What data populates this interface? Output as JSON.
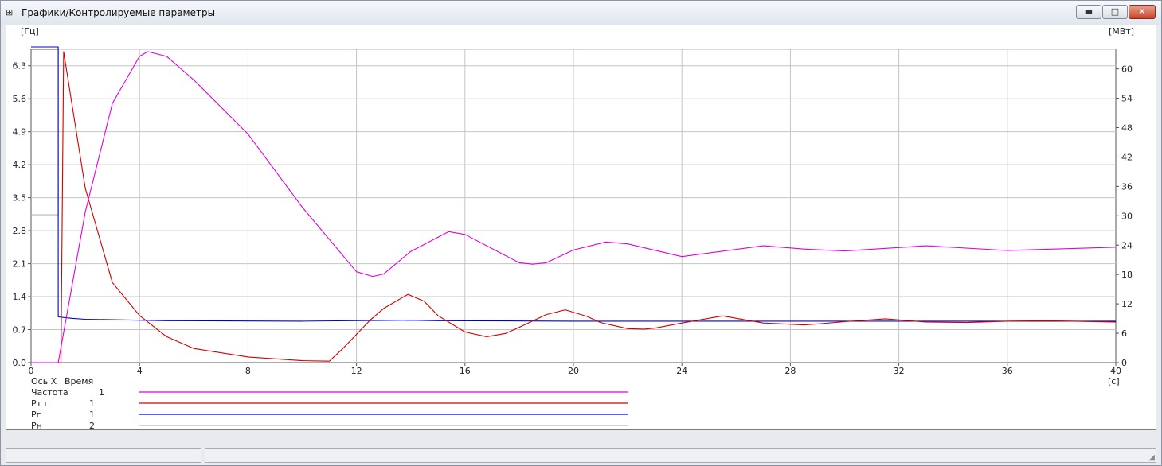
{
  "window": {
    "title": "Графики/Контролируемые параметры",
    "icon": "chart-app-icon",
    "controls": {
      "minimize": "▬",
      "maximize": "□",
      "close": "✕"
    }
  },
  "chart_data": {
    "type": "line",
    "left_unit": "[Гц]",
    "right_unit": "[МВт]",
    "x_unit": "[с]",
    "xlim": [
      0,
      40
    ],
    "ylim_left": [
      0,
      6.65
    ],
    "ylim_right": [
      0,
      64
    ],
    "x_ticks": [
      "0",
      "4",
      "8",
      "12",
      "16",
      "20",
      "24",
      "28",
      "32",
      "36",
      "40"
    ],
    "y_left_ticks": [
      "0.0",
      "0.7",
      "1.4",
      "2.1",
      "2.8",
      "3.5",
      "4.2",
      "4.9",
      "5.6",
      "6.3"
    ],
    "y_right_ticks": [
      "0",
      "6",
      "12",
      "18",
      "24",
      "30",
      "36",
      "42",
      "48",
      "54",
      "60"
    ],
    "grid": true,
    "legend_header": {
      "axis_x": "Ось X",
      "time": "Время"
    },
    "series": [
      {
        "name": "Частота",
        "axis": "1",
        "color": "#e000e0",
        "x": [
          0,
          1,
          2,
          3,
          4,
          4.3,
          5,
          6,
          8,
          10,
          12,
          12.6,
          13,
          14,
          15.4,
          16,
          18,
          18.5,
          19,
          20,
          21.2,
          22,
          24,
          27,
          28.5,
          30,
          33,
          36,
          40
        ],
        "y": [
          0,
          0,
          3.2,
          5.5,
          6.5,
          6.6,
          6.5,
          6.0,
          4.85,
          3.3,
          1.93,
          1.83,
          1.88,
          2.36,
          2.78,
          2.72,
          2.12,
          2.09,
          2.12,
          2.39,
          2.56,
          2.52,
          2.25,
          2.48,
          2.41,
          2.37,
          2.48,
          2.38,
          2.45
        ]
      },
      {
        "name": "Рт г",
        "axis": "1",
        "color": "#d00000",
        "x": [
          0,
          1.1,
          1.2,
          2,
          3,
          4,
          5,
          6,
          8,
          10,
          11,
          11.5,
          12,
          12.5,
          13,
          13.9,
          14.5,
          15,
          16,
          16.8,
          17.5,
          18,
          19,
          19.7,
          20.5,
          21,
          22,
          22.6,
          23,
          24,
          25.5,
          27,
          28.5,
          29,
          30,
          31.5,
          33,
          34.5,
          36,
          37.5,
          40
        ],
        "y": [
          0,
          0,
          6.6,
          3.7,
          1.7,
          1.0,
          0.55,
          0.3,
          0.12,
          0.04,
          0.03,
          0.3,
          0.6,
          0.9,
          1.15,
          1.45,
          1.3,
          1.0,
          0.65,
          0.55,
          0.62,
          0.75,
          1.02,
          1.12,
          0.98,
          0.85,
          0.72,
          0.71,
          0.73,
          0.84,
          0.99,
          0.84,
          0.8,
          0.82,
          0.87,
          0.93,
          0.86,
          0.85,
          0.88,
          0.89,
          0.86
        ]
      },
      {
        "name": "Рг",
        "axis": "1",
        "color": "#0000cc",
        "x": [
          0,
          1,
          1,
          1,
          1.5,
          2,
          3,
          5,
          10,
          14,
          15,
          20,
          25,
          30,
          35,
          40
        ],
        "y": [
          6.7,
          6.7,
          3.55,
          0.97,
          0.94,
          0.92,
          0.91,
          0.89,
          0.88,
          0.9,
          0.89,
          0.88,
          0.88,
          0.88,
          0.88,
          0.88
        ]
      },
      {
        "name": "Рн",
        "axis": "2",
        "color": "#b8b8b8",
        "x": [
          0,
          1,
          1,
          40
        ],
        "y": [
          30.2,
          30.2,
          64,
          64
        ]
      }
    ]
  }
}
